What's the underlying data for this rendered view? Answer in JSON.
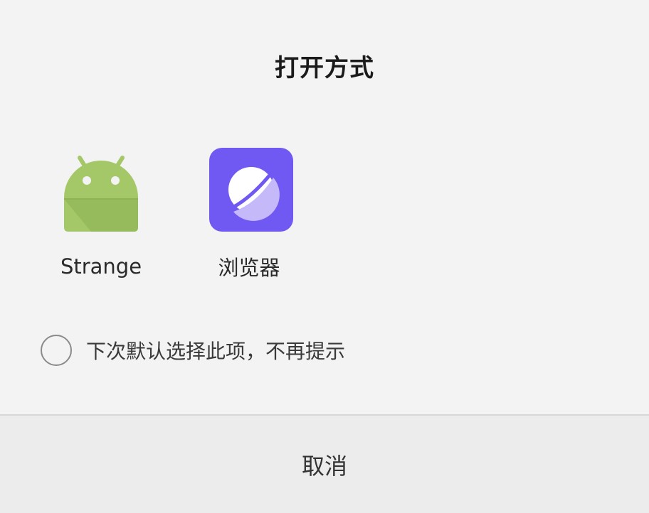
{
  "dialog": {
    "title": "打开方式",
    "apps": [
      {
        "label": "Strange",
        "icon": "android-icon",
        "icon_color": "#a4c868"
      },
      {
        "label": "浏览器",
        "icon": "browser-planet-icon",
        "icon_color": "#7059f2"
      }
    ],
    "remember_choice": {
      "label": "下次默认选择此项，不再提示",
      "checked": false
    },
    "cancel_label": "取消"
  }
}
